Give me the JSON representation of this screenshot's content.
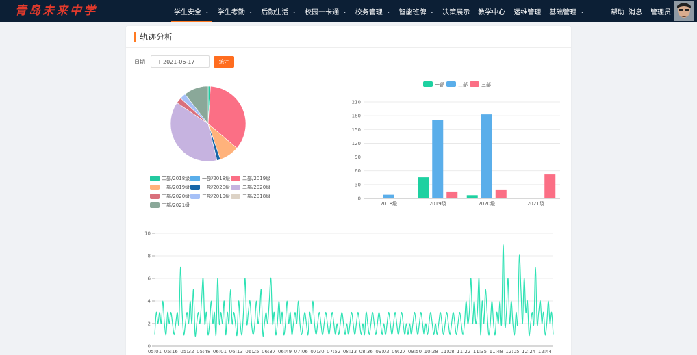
{
  "brand": {
    "logo_text": "青岛未来中学"
  },
  "nav": [
    {
      "label": "学生安全",
      "dropdown": true,
      "active": true
    },
    {
      "label": "学生考勤",
      "dropdown": true
    },
    {
      "label": "后勤生活",
      "dropdown": true
    },
    {
      "label": "校园一卡通",
      "dropdown": true
    },
    {
      "label": "校务管理",
      "dropdown": true
    },
    {
      "label": "智能班牌",
      "dropdown": true
    },
    {
      "label": "决策展示",
      "dropdown": false
    },
    {
      "label": "教学中心",
      "dropdown": false
    },
    {
      "label": "运维管理",
      "dropdown": false
    },
    {
      "label": "基础管理",
      "dropdown": true
    }
  ],
  "header_right": {
    "help": "帮助",
    "messages": "消息",
    "user": "管理员"
  },
  "page": {
    "title": "轨迹分析"
  },
  "filter": {
    "date_label": "日期",
    "date_value": "2021-06-17",
    "calendar_icon": "calendar-icon",
    "submit_label": "统计"
  },
  "colors": {
    "accent": "#ff7a22",
    "nav_bg": "#0c1f35",
    "line": "#2ee2b4"
  },
  "chart_data": [
    {
      "type": "pie",
      "slices": [
        {
          "name": "二部/2018级",
          "value": 1,
          "color": "#23c9a0"
        },
        {
          "name": "一部/2018级",
          "value": 0,
          "color": "#5aaeea"
        },
        {
          "name": "二部/2019级",
          "value": 35,
          "color": "#fb6f85"
        },
        {
          "name": "一部/2019级",
          "value": 8.5,
          "color": "#ffb27b"
        },
        {
          "name": "一部/2020级",
          "value": 1.5,
          "color": "#1766a8"
        },
        {
          "name": "二部/2020级",
          "value": 38,
          "color": "#c6b3e0"
        },
        {
          "name": "三部/2020级",
          "value": 2.5,
          "color": "#d9707c"
        },
        {
          "name": "三部/2019级",
          "value": 2.5,
          "color": "#a6c0f7"
        },
        {
          "name": "三部/2018级",
          "value": 0,
          "color": "#ddd3c6"
        },
        {
          "name": "三部/2021级",
          "value": 10.5,
          "color": "#8aa899"
        }
      ]
    },
    {
      "type": "bar",
      "categories": [
        "2018级",
        "2019级",
        "2020级",
        "2021级"
      ],
      "series": [
        {
          "name": "一部",
          "color": "#1ed1a1",
          "values": [
            0,
            46,
            7,
            0
          ]
        },
        {
          "name": "二部",
          "color": "#5aaeea",
          "values": [
            8,
            170,
            183,
            0
          ]
        },
        {
          "name": "三部",
          "color": "#fb6f85",
          "values": [
            0,
            15,
            18,
            52
          ]
        }
      ],
      "ylim": [
        0,
        210
      ],
      "yticks": [
        0,
        30,
        60,
        90,
        120,
        150,
        180,
        210
      ],
      "legend": "top-center"
    },
    {
      "type": "line",
      "color": "#2ee2b4",
      "ylim": [
        0,
        10
      ],
      "yticks": [
        0,
        2,
        4,
        6,
        8,
        10
      ],
      "xticks": [
        "05:01",
        "05:16",
        "05:32",
        "05:48",
        "06:01",
        "06:13",
        "06:25",
        "06:37",
        "06:49",
        "07:06",
        "07:30",
        "07:52",
        "08:13",
        "08:36",
        "09:03",
        "09:27",
        "09:50",
        "10:28",
        "11:08",
        "11:22",
        "11:35",
        "11:48",
        "12:05",
        "12:24",
        "12:44"
      ],
      "values": [
        1,
        3,
        2,
        3,
        2,
        4,
        2,
        1,
        3,
        2,
        3,
        2,
        1,
        2,
        3,
        2,
        7,
        3,
        1,
        2,
        3,
        2,
        4,
        2,
        5,
        1,
        2,
        3,
        2,
        4,
        6,
        2,
        3,
        1,
        2,
        4,
        2,
        3,
        1,
        6,
        2,
        3,
        2,
        4,
        1,
        3,
        2,
        5,
        2,
        3,
        2,
        1,
        4,
        2,
        1,
        3,
        6,
        2,
        3,
        4,
        2,
        1,
        2,
        4,
        2,
        3,
        5,
        1,
        2,
        3,
        2,
        4,
        6,
        2,
        3,
        1,
        2,
        4,
        2,
        3,
        1,
        2,
        4,
        2,
        3,
        1,
        2,
        3,
        2,
        4,
        2,
        1,
        2,
        3,
        2,
        1,
        3,
        2,
        4,
        2,
        1,
        2,
        3,
        2,
        1,
        2,
        3,
        2,
        1,
        2,
        3,
        2,
        1,
        2,
        1,
        2,
        3,
        2,
        1,
        2,
        1,
        2,
        3,
        2,
        1,
        2,
        3,
        2,
        1,
        2,
        1,
        3,
        2,
        1,
        2,
        3,
        2,
        1,
        2,
        3,
        2,
        1,
        2,
        1,
        2,
        3,
        2,
        1,
        2,
        3,
        2,
        1,
        2,
        3,
        2,
        1,
        2,
        1,
        2,
        1,
        2,
        3,
        2,
        1,
        2,
        3,
        2,
        1,
        2,
        1,
        2,
        3,
        2,
        1,
        2,
        1,
        2,
        3,
        2,
        1,
        2,
        3,
        2,
        1,
        2,
        3,
        2,
        1,
        2,
        3,
        2,
        1,
        2,
        4,
        2,
        3,
        6,
        2,
        4,
        2,
        3,
        6,
        1,
        4,
        2,
        5,
        3,
        1,
        2,
        4,
        2,
        1,
        3,
        2,
        4,
        2,
        9,
        2,
        3,
        6,
        2,
        4,
        2,
        1,
        3,
        2,
        8,
        5,
        2,
        6,
        3,
        4,
        1,
        2,
        3,
        2,
        7,
        2,
        3,
        4,
        2,
        3,
        1,
        2,
        4,
        2,
        3,
        1
      ]
    }
  ]
}
